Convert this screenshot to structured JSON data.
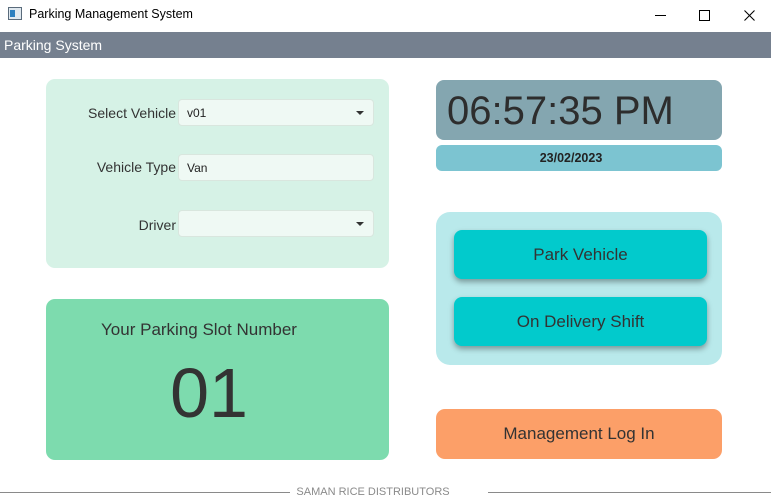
{
  "window": {
    "title": "Parking Management System",
    "icon": "app-window-icon"
  },
  "header": {
    "label": "Parking System"
  },
  "form": {
    "vehicle_label": "Select Vehicle",
    "vehicle_value": "v01",
    "type_label": "Vehicle Type",
    "type_value": "Van",
    "driver_label": "Driver",
    "driver_value": ""
  },
  "slot": {
    "title": "Your Parking Slot Number",
    "number": "01"
  },
  "clock": {
    "time": "06:57:35 PM",
    "date": "23/02/2023"
  },
  "actions": {
    "park_label": "Park Vehicle",
    "delivery_label": "On Delivery Shift",
    "management_label": "Management Log In"
  },
  "footer": {
    "text": "SAMAN RICE DISTRIBUTORS"
  },
  "colors": {
    "header_bar": "#75808f",
    "form_card": "#d6f2e6",
    "slot_card": "#7ddbae",
    "clock_bg": "#84a6b0",
    "date_bg": "#7cc4d1",
    "action_card": "#b9e9eb",
    "action_button": "#02cacc",
    "management_button": "#fc9f68"
  }
}
